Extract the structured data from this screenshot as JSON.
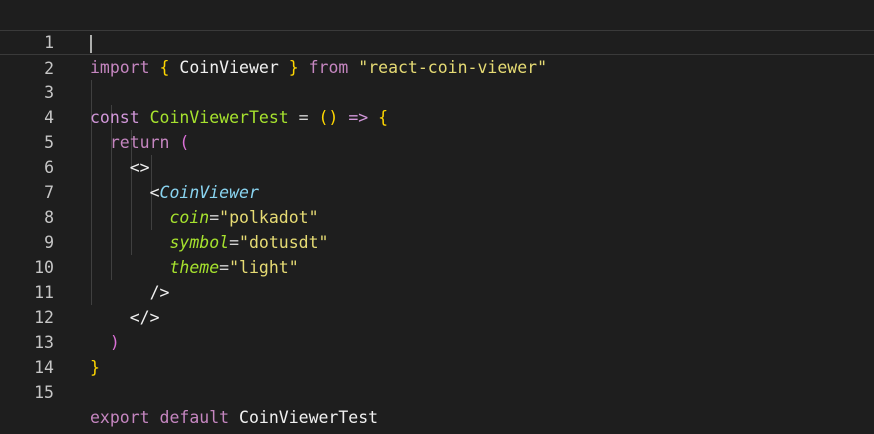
{
  "editor": {
    "line_numbers": [
      "1",
      "2",
      "3",
      "4",
      "5",
      "6",
      "7",
      "8",
      "9",
      "10",
      "11",
      "12",
      "13",
      "14",
      "15"
    ],
    "current_line": 2,
    "code": {
      "l1_import": "import",
      "l1_lbrace": "{",
      "l1_name": "CoinViewer",
      "l1_rbrace": "}",
      "l1_from": "from",
      "l1_module": "\"react-coin-viewer\"",
      "l3_const": "const",
      "l3_name": "CoinViewerTest",
      "l3_eq": "=",
      "l3_parens": "()",
      "l3_arrow": "=>",
      "l3_lbrace": "{",
      "l4_return": "return",
      "l4_lparen": "(",
      "l5_fragment_open": "<>",
      "l6_lt": "<",
      "l6_component": "CoinViewer",
      "l7_attr": "coin",
      "l7_eq": "=",
      "l7_val": "\"polkadot\"",
      "l8_attr": "symbol",
      "l8_eq": "=",
      "l8_val": "\"dotusdt\"",
      "l9_attr": "theme",
      "l9_eq": "=",
      "l9_val": "\"light\"",
      "l10_selfclose": "/>",
      "l11_fragment_close": "</>",
      "l12_rparen": ")",
      "l13_rbrace": "}",
      "l15_export": "export",
      "l15_default": "default",
      "l15_name": "CoinViewerTest"
    }
  }
}
